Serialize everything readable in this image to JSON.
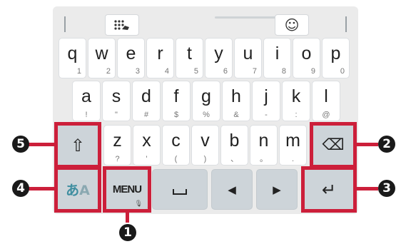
{
  "colors": {
    "callout": "#cc1f3a",
    "keyboard_bg": "#ebebeb",
    "dark_key": "#cdd4d9",
    "kana_accent": "#3f8ea0"
  },
  "toolbar": {
    "left_icon": "handwriting-keypad-icon",
    "right_icon": "emoji-icon",
    "emoji_glyph": "☺"
  },
  "row1": [
    {
      "main": "q",
      "sub": "1"
    },
    {
      "main": "w",
      "sub": "2"
    },
    {
      "main": "e",
      "sub": "3"
    },
    {
      "main": "r",
      "sub": "4"
    },
    {
      "main": "t",
      "sub": "5"
    },
    {
      "main": "y",
      "sub": "6"
    },
    {
      "main": "u",
      "sub": "7"
    },
    {
      "main": "i",
      "sub": "8"
    },
    {
      "main": "o",
      "sub": "9"
    },
    {
      "main": "p",
      "sub": "0"
    }
  ],
  "row2": [
    {
      "main": "a",
      "sub": "!"
    },
    {
      "main": "s",
      "sub": "\""
    },
    {
      "main": "d",
      "sub": "#"
    },
    {
      "main": "f",
      "sub": "$"
    },
    {
      "main": "g",
      "sub": "%"
    },
    {
      "main": "h",
      "sub": "&"
    },
    {
      "main": "j",
      "sub": "-"
    },
    {
      "main": "k",
      "sub": ":"
    },
    {
      "main": "l",
      "sub": "@"
    }
  ],
  "row3": [
    {
      "main": "z",
      "sub": "?"
    },
    {
      "main": "x",
      "sub": "'"
    },
    {
      "main": "c",
      "sub": "("
    },
    {
      "main": "v",
      "sub": ")"
    },
    {
      "main": "b",
      "sub": "、"
    },
    {
      "main": "n",
      "sub": "。"
    },
    {
      "main": "m",
      "sub": "."
    }
  ],
  "keys": {
    "shift_glyph": "⇧",
    "backspace_glyph": "⌫",
    "kana_label": "あ",
    "kana_label_a": "A",
    "menu_label": "MENU",
    "mic_glyph": "🎙",
    "space_glyph": "␣",
    "left_glyph": "◀",
    "right_glyph": "▶",
    "enter_glyph": "↵"
  },
  "callouts": [
    "1",
    "2",
    "3",
    "4",
    "5"
  ]
}
